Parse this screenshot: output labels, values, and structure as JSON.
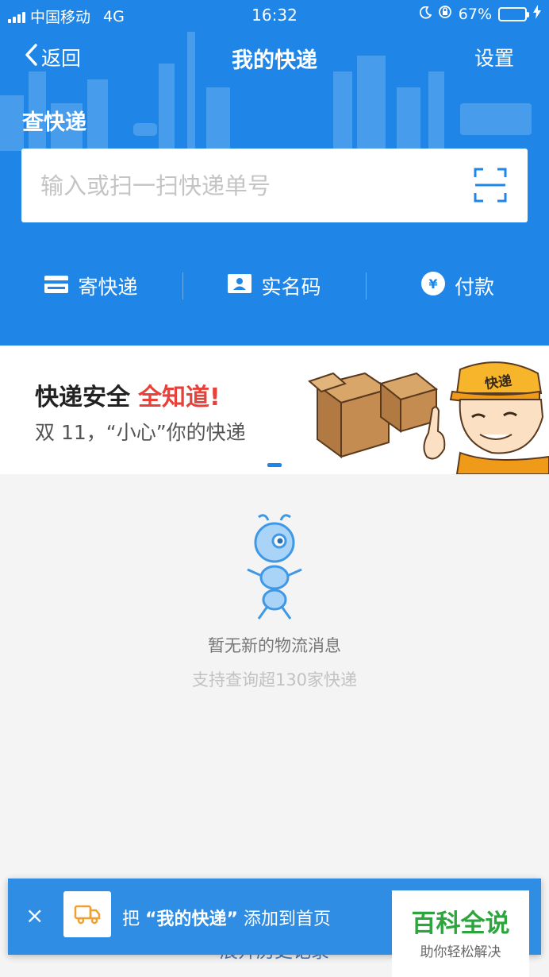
{
  "status_bar": {
    "carrier": "中国移动",
    "network": "4G",
    "time": "16:32",
    "battery_percent": "67%",
    "battery_level": 0.67
  },
  "navbar": {
    "back_label": "返回",
    "title": "我的快递",
    "settings_label": "设置"
  },
  "query": {
    "section_title": "查快递",
    "placeholder": "输入或扫一扫快递单号",
    "value": ""
  },
  "actions": [
    {
      "label": "寄快递",
      "icon": "card-icon"
    },
    {
      "label": "实名码",
      "icon": "id-badge-icon"
    },
    {
      "label": "付款",
      "icon": "yen-coin-icon"
    }
  ],
  "banner": {
    "title_main": "快递安全",
    "title_highlight": "全知道!",
    "subtitle": "双 11，“小心”你的快递",
    "courier_cap_text": "快递"
  },
  "empty_state": {
    "message": "暂无新的物流消息",
    "sub": "支持查询超130家快递"
  },
  "history_label": "展开历史记录",
  "add_bar": {
    "close_glyph": "×",
    "prefix": "把",
    "app_name": "“我的快递”",
    "suffix": "添加到首页"
  },
  "watermark": {
    "title": "百科全说",
    "subtitle": "助你轻松解决"
  },
  "colors": {
    "primary_blue": "#1f86e8",
    "highlight_red": "#e8413a",
    "watermark_green": "#2ba53c"
  }
}
